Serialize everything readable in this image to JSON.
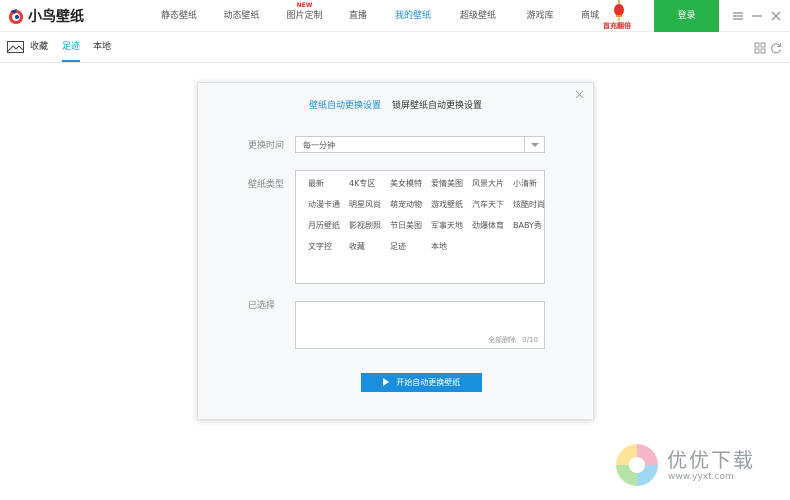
{
  "app": {
    "name": "小鸟壁纸"
  },
  "nav": {
    "items": [
      {
        "label": "静态壁纸"
      },
      {
        "label": "动态壁纸"
      },
      {
        "label": "图片定制",
        "badge": "NEW"
      },
      {
        "label": "直播"
      },
      {
        "label": "我的壁纸",
        "active": true
      },
      {
        "label": "超级壁纸"
      },
      {
        "label": "游戏库"
      },
      {
        "label": "商城"
      }
    ],
    "promo_label": "首充翻倍",
    "login_label": "登录"
  },
  "subnav": {
    "items": [
      {
        "label": "收藏"
      },
      {
        "label": "足迹",
        "active": true
      },
      {
        "label": "本地"
      }
    ]
  },
  "panel": {
    "tabs": [
      {
        "label": "壁纸自动更换设置",
        "active": true
      },
      {
        "label": "锁屏壁纸自动更换设置"
      }
    ],
    "interval": {
      "label": "更换时间",
      "value": "每一分钟"
    },
    "types": {
      "label": "壁纸类型",
      "options": [
        "最新",
        "4K专区",
        "美女模特",
        "爱情美图",
        "风景大片",
        "小清新",
        "动漫卡通",
        "明星风尚",
        "萌宠动物",
        "游戏壁纸",
        "汽车天下",
        "炫酷时尚",
        "月历壁纸",
        "影视剧照",
        "节日美图",
        "军事天地",
        "劲爆体育",
        "BABY秀",
        "文字控",
        "收藏",
        "足迹",
        "本地"
      ]
    },
    "selected": {
      "label": "已选择",
      "clear_all": "全部删除",
      "count": "0/10"
    },
    "start_button": "开始自动更换壁纸"
  },
  "watermark": {
    "title": "优优下载",
    "url": "www.yyxt.com"
  },
  "colors": {
    "accent": "#1b8fd8",
    "login": "#27b24a",
    "promo": "#e8302b"
  }
}
